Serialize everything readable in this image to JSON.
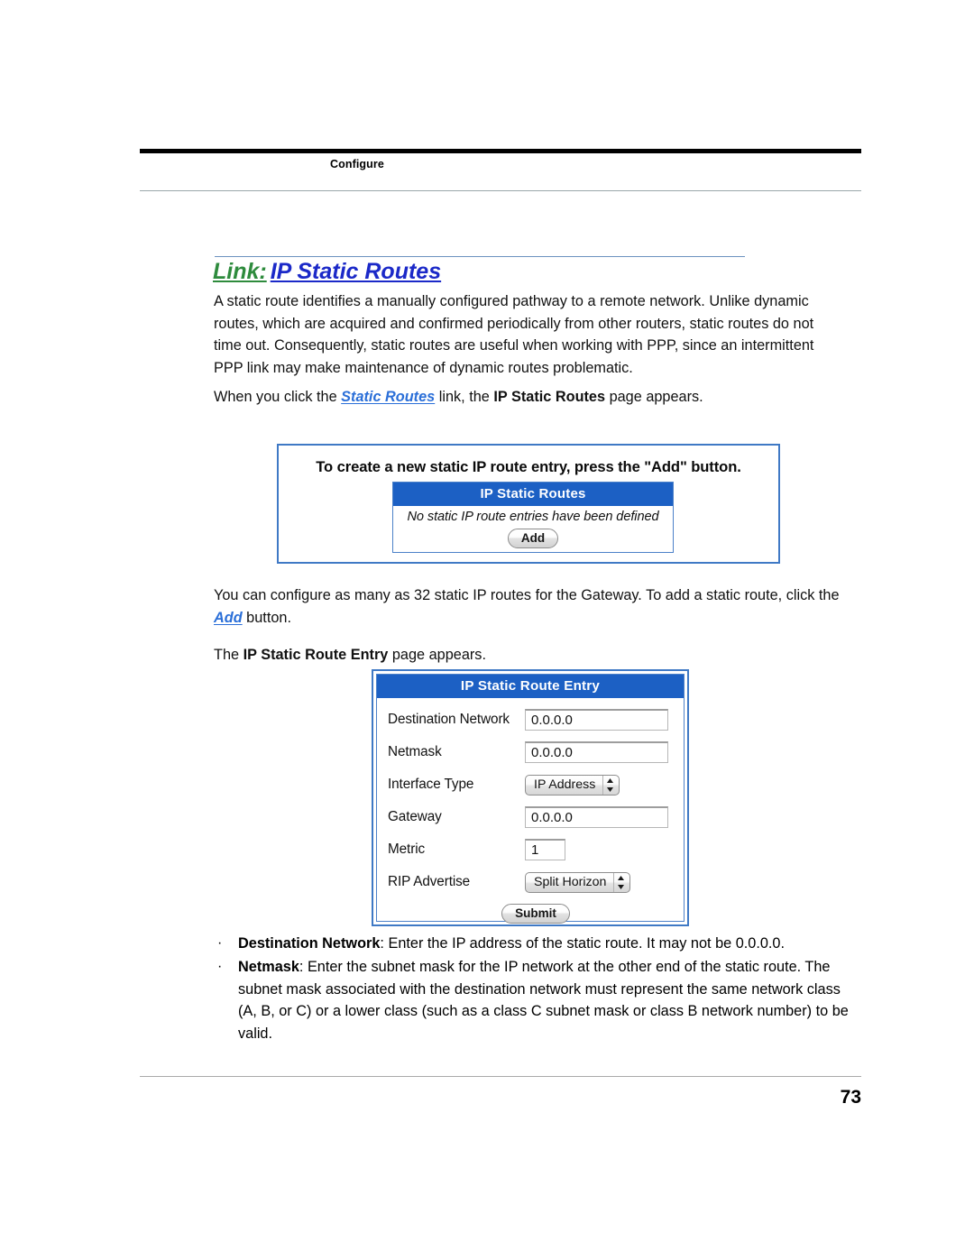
{
  "header": {
    "running_head": "Configure"
  },
  "section": {
    "title_link_word": "Link:",
    "title_name": "IP Static Routes"
  },
  "paragraphs": {
    "p1": "A static route identifies a manually configured pathway to a remote network. Unlike dynamic routes, which are acquired and confirmed periodically from other routers, static routes do not time out. Consequently, static routes are useful when working with PPP, since an intermittent PPP link may make maintenance of dynamic routes problematic.",
    "p2_before": "When you click the ",
    "p2_link": "Static Routes",
    "p2_middle": " link, the ",
    "p2_bold": "IP Static Routes",
    "p2_after": " page appears.",
    "p3_before": "You can configure as many as 32 static IP routes for the Gateway. To add a static route, click the ",
    "p3_link": "Add",
    "p3_after": " button.",
    "p4_before": "The ",
    "p4_bold": "IP Static Route Entry",
    "p4_after": " page appears."
  },
  "figure_routes": {
    "caption": "To create a new static IP route entry, press the \"Add\" button.",
    "panel_title": "IP Static Routes",
    "empty_message": "No static IP route entries have been defined",
    "add_button": "Add"
  },
  "figure_entry": {
    "panel_title": "IP Static Route Entry",
    "fields": [
      {
        "label": "Destination Network",
        "value": "0.0.0.0",
        "type": "text"
      },
      {
        "label": "Netmask",
        "value": "0.0.0.0",
        "type": "text"
      },
      {
        "label": "Interface Type",
        "value": "IP Address",
        "type": "popup"
      },
      {
        "label": "Gateway",
        "value": "0.0.0.0",
        "type": "text"
      },
      {
        "label": "Metric",
        "value": "1",
        "type": "text-narrow"
      },
      {
        "label": "RIP Advertise",
        "value": "Split Horizon",
        "type": "popup"
      }
    ],
    "submit_button": "Submit"
  },
  "bullets": [
    {
      "marker": "·",
      "term": "Destination Network",
      "text": ": Enter the IP address of the static route. It may not be 0.0.0.0."
    },
    {
      "marker": "·",
      "term": "Netmask",
      "text": ": Enter the subnet mask for the IP network at the other end of the static route. The subnet mask associated with the destination network must represent the same network class (A, B, or C) or a lower class (such as a class C subnet mask or class B network number) to be valid."
    }
  ],
  "footer": {
    "page_number": "73"
  },
  "colors": {
    "panel_header_blue": "#1c60c4",
    "frame_blue": "#3f79c5",
    "link_green": "#2e8b3d",
    "link_blue": "#1b29c8",
    "inline_link_blue": "#2b6fd8"
  }
}
